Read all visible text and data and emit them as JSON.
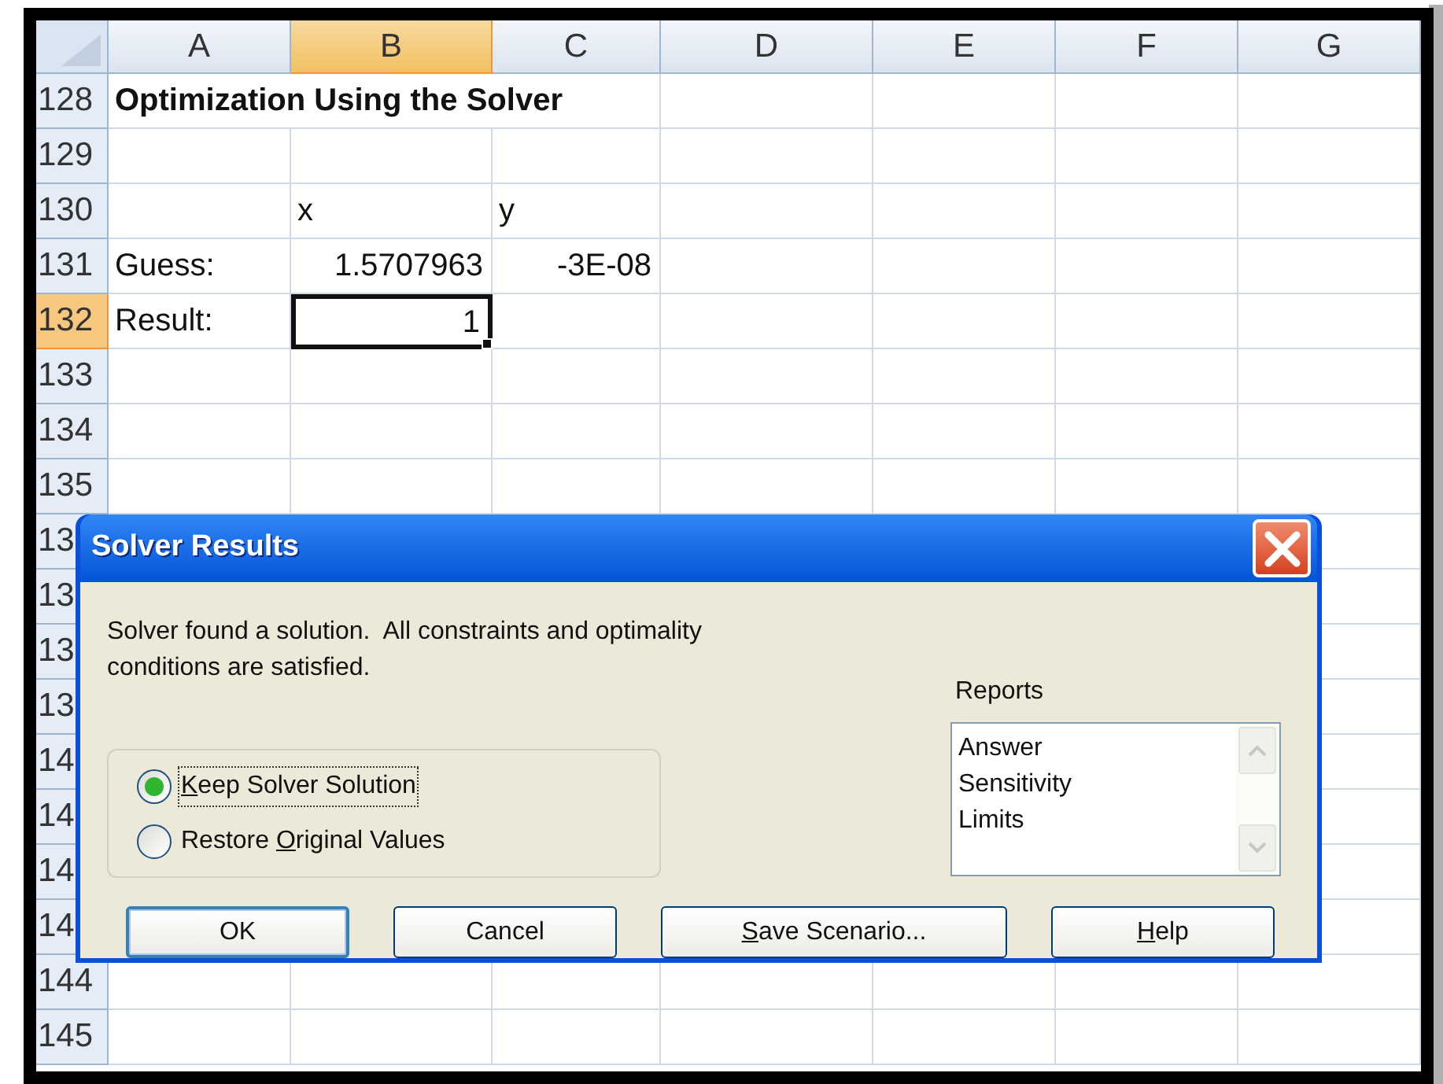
{
  "sheet": {
    "columns": [
      {
        "label": "A",
        "selected": false
      },
      {
        "label": "B",
        "selected": true
      },
      {
        "label": "C",
        "selected": false
      },
      {
        "label": "D",
        "selected": false
      },
      {
        "label": "E",
        "selected": false
      },
      {
        "label": "F",
        "selected": false
      },
      {
        "label": "G",
        "selected": false
      }
    ],
    "rows": [
      {
        "number": "128",
        "selected": false,
        "kind": "title",
        "title": "Optimization Using the Solver"
      },
      {
        "number": "129",
        "selected": false,
        "kind": "plain"
      },
      {
        "number": "130",
        "selected": false,
        "kind": "plain",
        "cells": {
          "b": {
            "kind": "text",
            "text": "x",
            "selected": false
          },
          "c": {
            "kind": "text",
            "text": "y",
            "selected": false
          }
        }
      },
      {
        "number": "131",
        "selected": false,
        "kind": "plain",
        "cells": {
          "a": {
            "kind": "text",
            "text": "Guess:",
            "selected": false
          },
          "b": {
            "kind": "number",
            "text": "1.5707963",
            "selected": false
          },
          "c": {
            "kind": "number",
            "text": "-3E-08",
            "selected": false
          }
        }
      },
      {
        "number": "132",
        "selected": true,
        "kind": "plain",
        "cells": {
          "a": {
            "kind": "text",
            "text": "Result:",
            "selected": false
          },
          "b": {
            "kind": "number",
            "text": "1",
            "selected": true
          }
        }
      },
      {
        "number": "133",
        "selected": false,
        "kind": "plain"
      },
      {
        "number": "134",
        "selected": false,
        "kind": "plain"
      },
      {
        "number": "135",
        "selected": false,
        "kind": "plain"
      },
      {
        "number": "13",
        "selected": false,
        "kind": "plain"
      },
      {
        "number": "13",
        "selected": false,
        "kind": "plain"
      },
      {
        "number": "13",
        "selected": false,
        "kind": "plain"
      },
      {
        "number": "13",
        "selected": false,
        "kind": "plain"
      },
      {
        "number": "14",
        "selected": false,
        "kind": "plain"
      },
      {
        "number": "14",
        "selected": false,
        "kind": "plain"
      },
      {
        "number": "14",
        "selected": false,
        "kind": "plain"
      },
      {
        "number": "14",
        "selected": false,
        "kind": "plain"
      },
      {
        "number": "144",
        "selected": false,
        "kind": "plain"
      },
      {
        "number": "145",
        "selected": false,
        "kind": "plain"
      }
    ]
  },
  "dialog": {
    "title": "Solver Results",
    "message": "Solver found a solution.  All constraints and optimality conditions are satisfied.",
    "options": [
      {
        "label": {
          "key": "K",
          "after": "eep Solver Solution"
        },
        "selected": true,
        "focused": true
      },
      {
        "label": {
          "before": "Restore ",
          "key": "O",
          "after": "riginal Values"
        },
        "selected": false,
        "focused": false
      }
    ],
    "reports": {
      "label": "Reports",
      "items": [
        "Answer",
        "Sensitivity",
        "Limits"
      ]
    },
    "buttons": [
      {
        "label": {
          "before": "OK"
        },
        "default": true
      },
      {
        "label": {
          "before": "Cancel"
        },
        "default": false
      },
      {
        "label": {
          "key": "S",
          "after": "ave Scenario..."
        },
        "default": false
      },
      {
        "label": {
          "key": "H",
          "after": "elp"
        },
        "default": false
      }
    ]
  }
}
